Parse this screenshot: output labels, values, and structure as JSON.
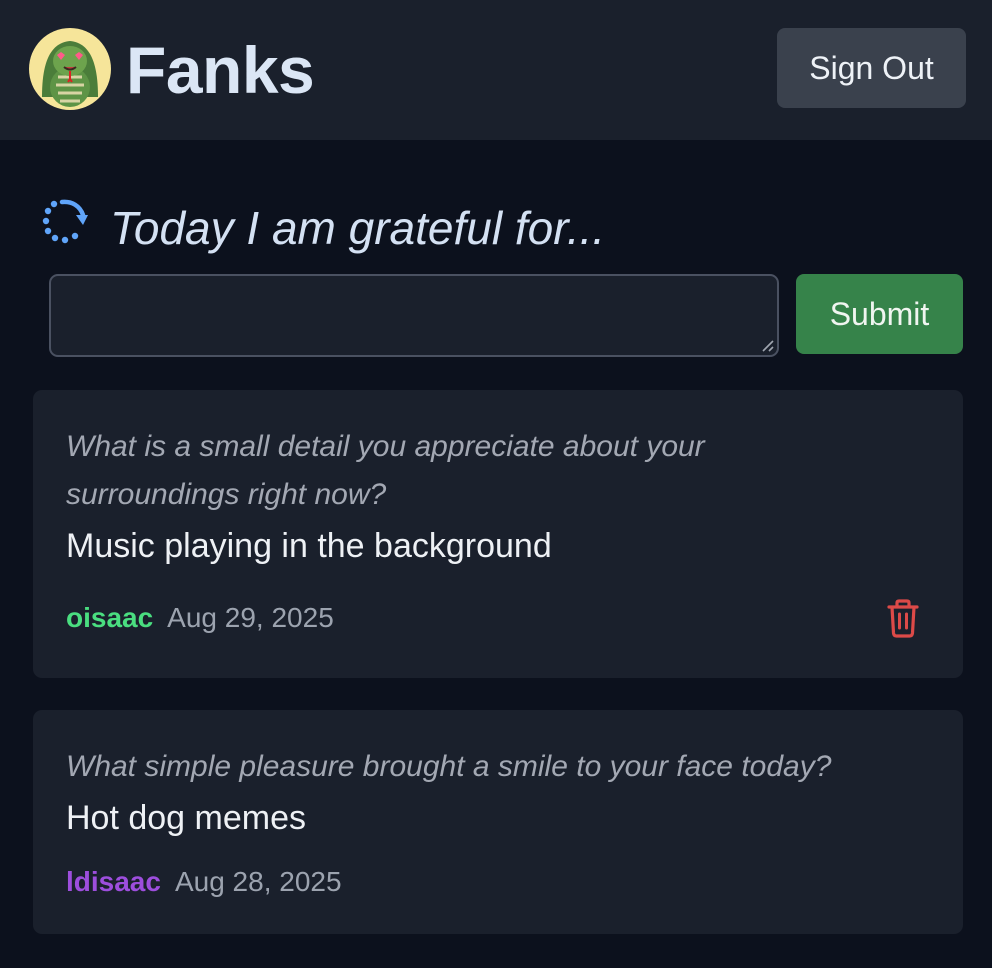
{
  "header": {
    "app_title": "Fanks",
    "logo_icon": "snake-mascot-icon",
    "sign_out_label": "Sign Out"
  },
  "compose": {
    "refresh_icon": "refresh-icon",
    "prompt": "Today I am grateful for...",
    "input_value": "",
    "input_placeholder": "",
    "submit_label": "Submit"
  },
  "entries": [
    {
      "question": "What is a small detail you appreciate about your surroundings right now?",
      "answer": "Music playing in the background",
      "username": "oisaac",
      "username_color": "#4ade80",
      "date": "Aug 29, 2025",
      "delete_icon": "trash-icon"
    },
    {
      "question": "What simple pleasure brought a smile to your face today?",
      "answer": "Hot dog memes",
      "username": "ldisaac",
      "username_color": "#9d4edd",
      "date": "Aug 28, 2025"
    }
  ],
  "colors": {
    "background": "#0c111d",
    "surface": "#1a202c",
    "submit_green": "#36834a",
    "delete_red": "#dc4a48",
    "accent_blue": "#60a5fa"
  }
}
